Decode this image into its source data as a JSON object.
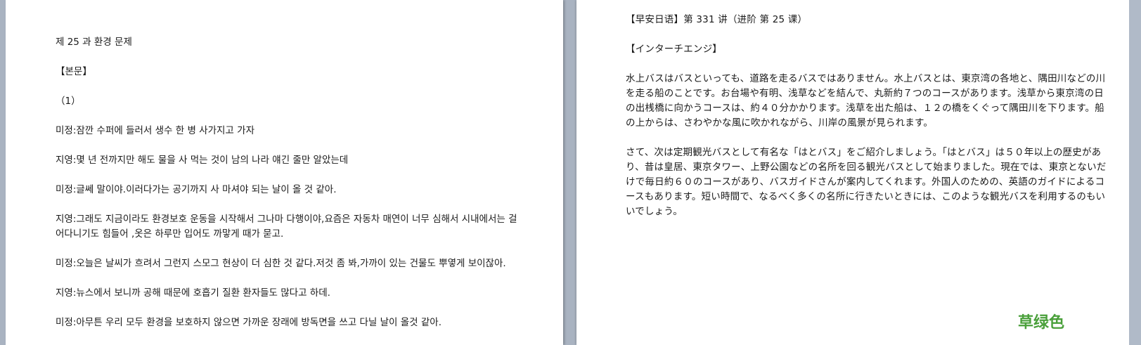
{
  "left_page": {
    "paragraphs": [
      "제 25 과 환경 문제",
      "【본문】",
      "（1）",
      "미정:잠깐 수퍼에 들러서 생수 한 병 사가지고 가자",
      "지영:몇 년 전까지만 해도 물을 사 먹는 것이 남의 나라 얘긴 줄만 알았는데",
      "미정:글쎄 말이야.이러다가는 공기까지 사 마셔야 되는 날이 올 것 같아.",
      "지영:그래도 지금이라도 환경보호 운동을 시작해서 그나마 다행이야,요즘은 자동차 매연이 너무 심해서 시내에서는 걸어다니기도 힘들어 ,옷은 하루만 입어도 까맣게 때가 묻고.",
      "미정:오늘은 날씨가 흐려서 그런지 스모그 현상이 더 심한 것 같다.저것 좀 봐,가까이 있는 건물도 뿌옇게 보이잖아.",
      "지영:뉴스에서 보니까 공해 때문에 호흡기 질환 환자들도 많다고 하데.",
      "미정:아무튼 우리 모두 환경을 보호하지 않으면 가까운 장래에 방독면을 쓰고 다닐 날이 올것 같아."
    ]
  },
  "right_page": {
    "paragraphs": [
      "【早安日语】第 331 讲（进阶 第 25 课）",
      "【インターチエンジ】",
      "水上バスはバスといっても、道路を走るバスではありません。水上バスとは、東京湾の各地と、隅田川などの川を走る船のことです。お台場や有明、浅草などを結んで、丸新約７つのコースがあります。浅草から東京湾の日の出桟橋に向かうコースは、約４０分かかります。浅草を出た船は、１２の橋をくぐって隅田川を下ります。船の上からは、さわやかな風に吹かれながら、川岸の風景が見られます。",
      "さて、次は定期観光バスとして有名な「はとバス」をご紹介しましょう。「はとバス」は５０年以上の歴史があり、昔は皇居、東京タワー、上野公園などの名所を回る観光バスとして始まりました。現在では、東京とないだけで毎日約６０のコースがあり、バスガイドさんが案内してくれます。外国人のための、英語のガイドによるコースもあります。短い時間で、なるべく多くの名所に行きたいときには、このような観光バスを利用するのもいいでしょう。"
    ],
    "watermark": "草绿色"
  },
  "colors": {
    "background": "#a9b3c1",
    "page": "#ffffff",
    "text": "#1a1a1a",
    "watermark": "#4aa03b"
  }
}
